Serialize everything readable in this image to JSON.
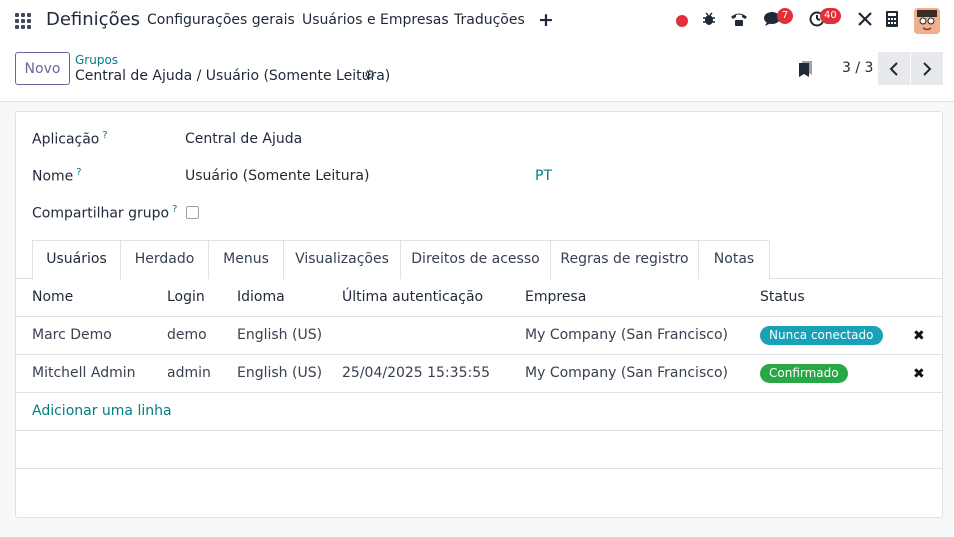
{
  "topbar": {
    "brand": "Definições",
    "menu": [
      "Configurações gerais",
      "Usuários e Empresas",
      "Traduções"
    ],
    "plus_icon": "plus-icon",
    "messages_count": "7",
    "activities_count": "40"
  },
  "controlbar": {
    "new_label": "Novo",
    "breadcrumb_parent": "Grupos",
    "breadcrumb_current": "Central de Ajuda / Usuário (Somente Leitura)",
    "pager": "3 / 3"
  },
  "form": {
    "application_label": "Aplicação",
    "application_value": "Central de Ajuda",
    "name_label": "Nome",
    "name_value": "Usuário (Somente Leitura)",
    "name_lang": "PT",
    "share_label": "Compartilhar grupo",
    "help_mark": "?"
  },
  "tabs": [
    "Usuários",
    "Herdado",
    "Menus",
    "Visualizações",
    "Direitos de acesso",
    "Regras de registro",
    "Notas"
  ],
  "table": {
    "headers": [
      "Nome",
      "Login",
      "Idioma",
      "Última autenticação",
      "Empresa",
      "Status"
    ],
    "rows": [
      {
        "name": "Marc Demo",
        "login": "demo",
        "lang": "English (US)",
        "last": "",
        "company": "My Company (San Francisco)",
        "status": "Nunca conectado"
      },
      {
        "name": "Mitchell Admin",
        "login": "admin",
        "lang": "English (US)",
        "last": "25/04/2025 15:35:55",
        "company": "My Company (San Francisco)",
        "status": "Confirmado"
      }
    ],
    "add_line": "Adicionar uma linha"
  },
  "colors": {
    "accent": "#017e84",
    "primary": "#71639e",
    "status_never": "#17a2b8",
    "status_confirmed": "#28a745",
    "badge": "#e0313b"
  }
}
